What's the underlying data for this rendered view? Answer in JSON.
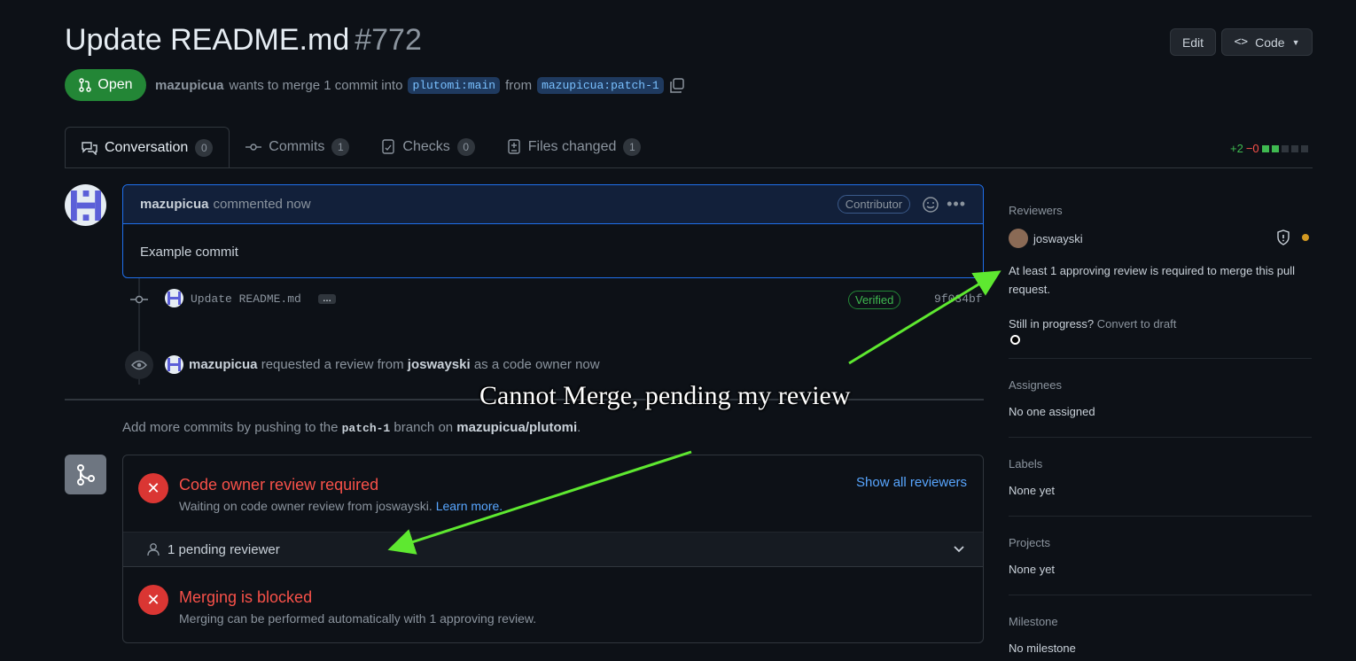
{
  "header": {
    "title": "Update README.md",
    "number": "#772",
    "edit_label": "Edit",
    "code_label": "Code",
    "state": "Open",
    "author": "mazupicua",
    "merge_text": "wants to merge 1 commit into",
    "base_branch": "plutomi:main",
    "from_text": "from",
    "head_branch": "mazupicua:patch-1"
  },
  "tabs": [
    {
      "label": "Conversation",
      "count": "0",
      "icon": "conversation-icon"
    },
    {
      "label": "Commits",
      "count": "1",
      "icon": "commit-icon"
    },
    {
      "label": "Checks",
      "count": "0",
      "icon": "checks-icon"
    },
    {
      "label": "Files changed",
      "count": "1",
      "icon": "file-diff-icon"
    }
  ],
  "diffstat": {
    "additions": "+2",
    "deletions": "−0",
    "colors": {
      "add": "#3fb950",
      "neutral": "#30363d"
    }
  },
  "comment": {
    "author": "mazupicua",
    "time": "commented now",
    "badge": "Contributor",
    "body": "Example commit"
  },
  "commit": {
    "message": "Update README.md",
    "ellipsis": "…",
    "verified": "Verified",
    "sha": "9f034bf"
  },
  "review_event": {
    "actor": "mazupicua",
    "text1": "requested a review from",
    "reviewer": "joswayski",
    "text2": "as a code owner now"
  },
  "push_hint": {
    "text1": "Add more commits by pushing to the",
    "branch": "patch-1",
    "text2": "branch on",
    "repo": "mazupicua/plutomi",
    "end": "."
  },
  "merge_box": {
    "review_title": "Code owner review required",
    "review_desc": "Waiting on code owner review from joswayski.",
    "learn_more": "Learn more.",
    "show_all": "Show all reviewers",
    "pending": "1 pending reviewer",
    "blocked_title": "Merging is blocked",
    "blocked_desc": "Merging can be performed automatically with 1 approving review."
  },
  "sidebar": {
    "reviewers_h": "Reviewers",
    "reviewer": "joswayski",
    "approval_note": "At least 1 approving review is required to merge this pull request.",
    "still_text": "Still in progress?",
    "convert": "Convert to draft",
    "assignees_h": "Assignees",
    "assignees_v": "No one assigned",
    "labels_h": "Labels",
    "labels_v": "None yet",
    "projects_h": "Projects",
    "projects_v": "None yet",
    "milestone_h": "Milestone",
    "milestone_v": "No milestone"
  },
  "annotation": {
    "text": "Cannot Merge, pending my review",
    "arrow_color": "#5ee830"
  }
}
